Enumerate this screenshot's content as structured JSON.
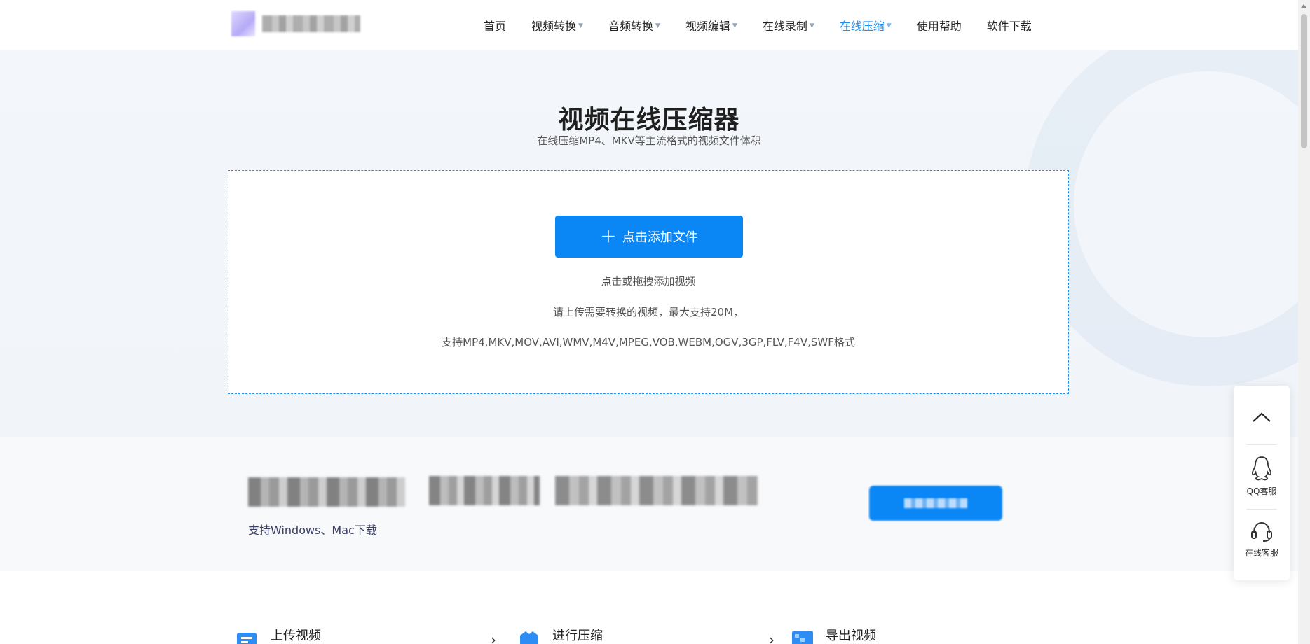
{
  "nav": {
    "items": [
      {
        "label": "首页",
        "dropdown": false,
        "active": false
      },
      {
        "label": "视频转换",
        "dropdown": true,
        "active": false
      },
      {
        "label": "音频转换",
        "dropdown": true,
        "active": false
      },
      {
        "label": "视频编辑",
        "dropdown": true,
        "active": false
      },
      {
        "label": "在线录制",
        "dropdown": true,
        "active": false
      },
      {
        "label": "在线压缩",
        "dropdown": true,
        "active": true
      },
      {
        "label": "使用帮助",
        "dropdown": false,
        "active": false
      },
      {
        "label": "软件下载",
        "dropdown": false,
        "active": false
      }
    ]
  },
  "hero": {
    "title": "视频在线压缩器",
    "subtitle": "在线压缩MP4、MKV等主流格式的视频文件体积"
  },
  "upload": {
    "button_label": "点击添加文件",
    "hint": "点击或拖拽添加视频",
    "limit": "请上传需要转换的视频，最大支持20M，",
    "formats": "支持MP4,MKV,MOV,AVI,WMV,M4V,MPEG,VOB,WEBM,OGV,3GP,FLV,F4V,SWF格式"
  },
  "banner": {
    "note": "支持Windows、Mac下载"
  },
  "steps": [
    {
      "label": "上传视频",
      "icon": "upload-video-icon"
    },
    {
      "label": "进行压缩",
      "icon": "compress-icon"
    },
    {
      "label": "导出视频",
      "icon": "export-video-icon"
    }
  ],
  "float_panel": {
    "qq_label": "QQ客服",
    "service_label": "在线客服"
  },
  "colors": {
    "accent": "#1b8ef8",
    "button": "#0a86f5",
    "hero_bg": "#f3f7fb"
  }
}
